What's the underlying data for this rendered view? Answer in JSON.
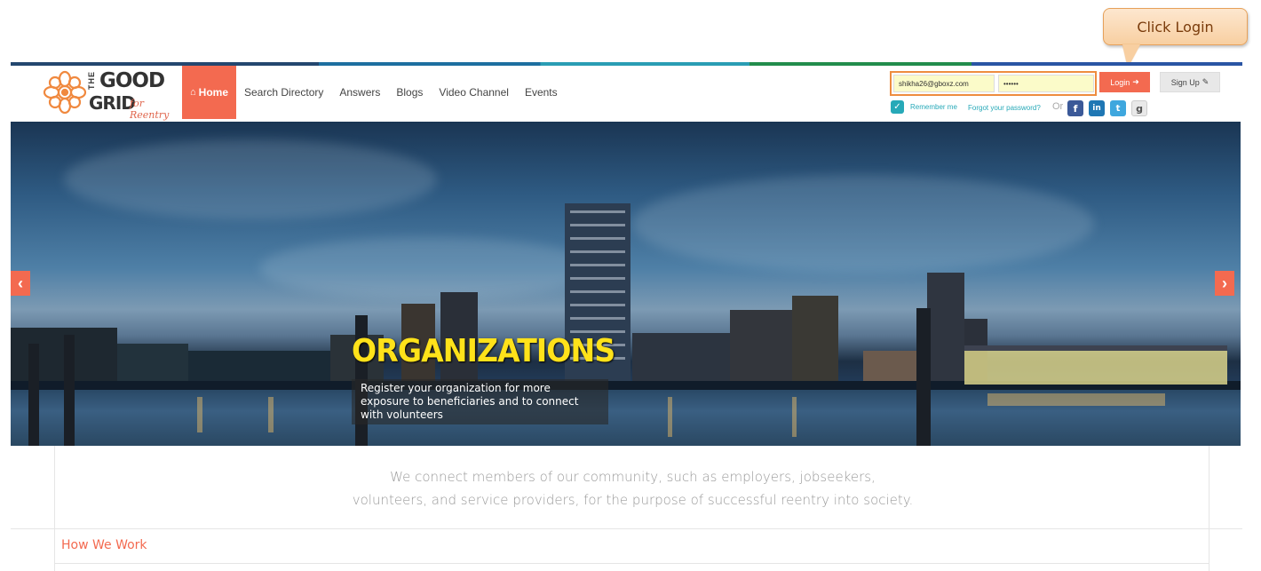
{
  "callout": {
    "text": "Click Login"
  },
  "logo": {
    "the": "THE",
    "good": "GOOD",
    "grid": "GRID",
    "reentry": "for Reentry"
  },
  "nav": {
    "items": [
      {
        "label": "Home",
        "active": true
      },
      {
        "label": "Search Directory"
      },
      {
        "label": "Answers"
      },
      {
        "label": "Blogs"
      },
      {
        "label": "Video Channel"
      },
      {
        "label": "Events"
      }
    ]
  },
  "login": {
    "email_value": "shikha26@gboxz.com",
    "password_value": "••••••",
    "login_label": "Login",
    "signup_label": "Sign Up",
    "remember_label": "Remember me",
    "forgot_label": "Forgot your password?",
    "or_label": "Or"
  },
  "social": {
    "facebook": "f",
    "linkedin": "in",
    "twitter": "t",
    "google": "g"
  },
  "hero": {
    "title": "ORGANIZATIONS",
    "subtitle": "Register your organization for more exposure to beneficiaries and to connect with volunteers",
    "prev_glyph": "‹",
    "next_glyph": "›"
  },
  "tagline": {
    "line1": "We connect members of our community, such as employers, jobseekers,",
    "line2": "volunteers, and service providers, for the purpose of successful reentry into society."
  },
  "section": {
    "how_we_work": "How We Work"
  },
  "colors": {
    "accent": "#f36a50",
    "teal": "#27a9b8",
    "callout": "#f8cfa1",
    "highlight_border": "#ee8d3f"
  }
}
